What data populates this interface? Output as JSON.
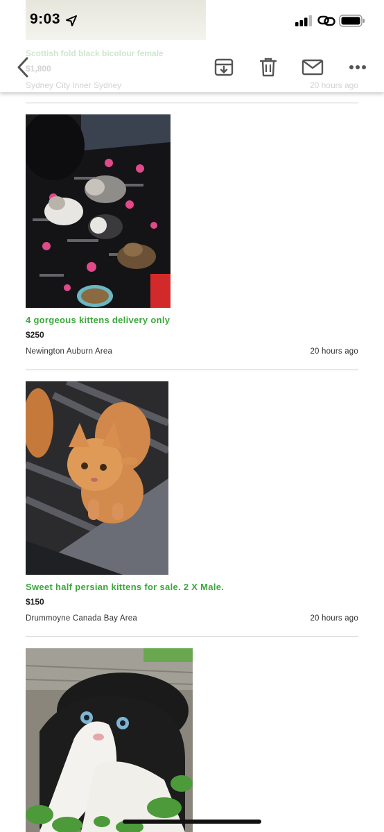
{
  "status_bar": {
    "time": "9:03",
    "location_icon": "location-arrow-icon",
    "signal_icon": "cellular-signal-icon",
    "link_icon": "link-icon",
    "battery_icon": "battery-icon"
  },
  "toolbar": {
    "back_icon": "chevron-left-icon",
    "archive_icon": "archive-icon",
    "trash_icon": "trash-icon",
    "mail_icon": "mail-icon",
    "more_icon": "more-horizontal-icon"
  },
  "peek_listing": {
    "title": "Scottish fold black bicolour female",
    "price": "$1,800",
    "location": "Sydney City Inner Sydney",
    "time": "20 hours ago"
  },
  "listings": [
    {
      "title": "4 gorgeous kittens delivery only",
      "price": "$250",
      "location": "Newington Auburn Area",
      "time": "20 hours ago",
      "image": "photo of four kittens on a dark patterned blanket"
    },
    {
      "title": "Sweet half persian kittens for sale. 2 X Male.",
      "price": "$150",
      "location": "Drummoyne Canada Bay Area",
      "time": "20 hours ago",
      "image": "photo of a ginger kitten on a striped mat"
    },
    {
      "title": "",
      "price": "",
      "location": "",
      "time": "",
      "image": "photo of a black and white fold-eared kitten in grass"
    }
  ],
  "colors": {
    "link_green": "#3aa83a",
    "divider": "#c8c8c8",
    "icon_gray": "#555555"
  }
}
